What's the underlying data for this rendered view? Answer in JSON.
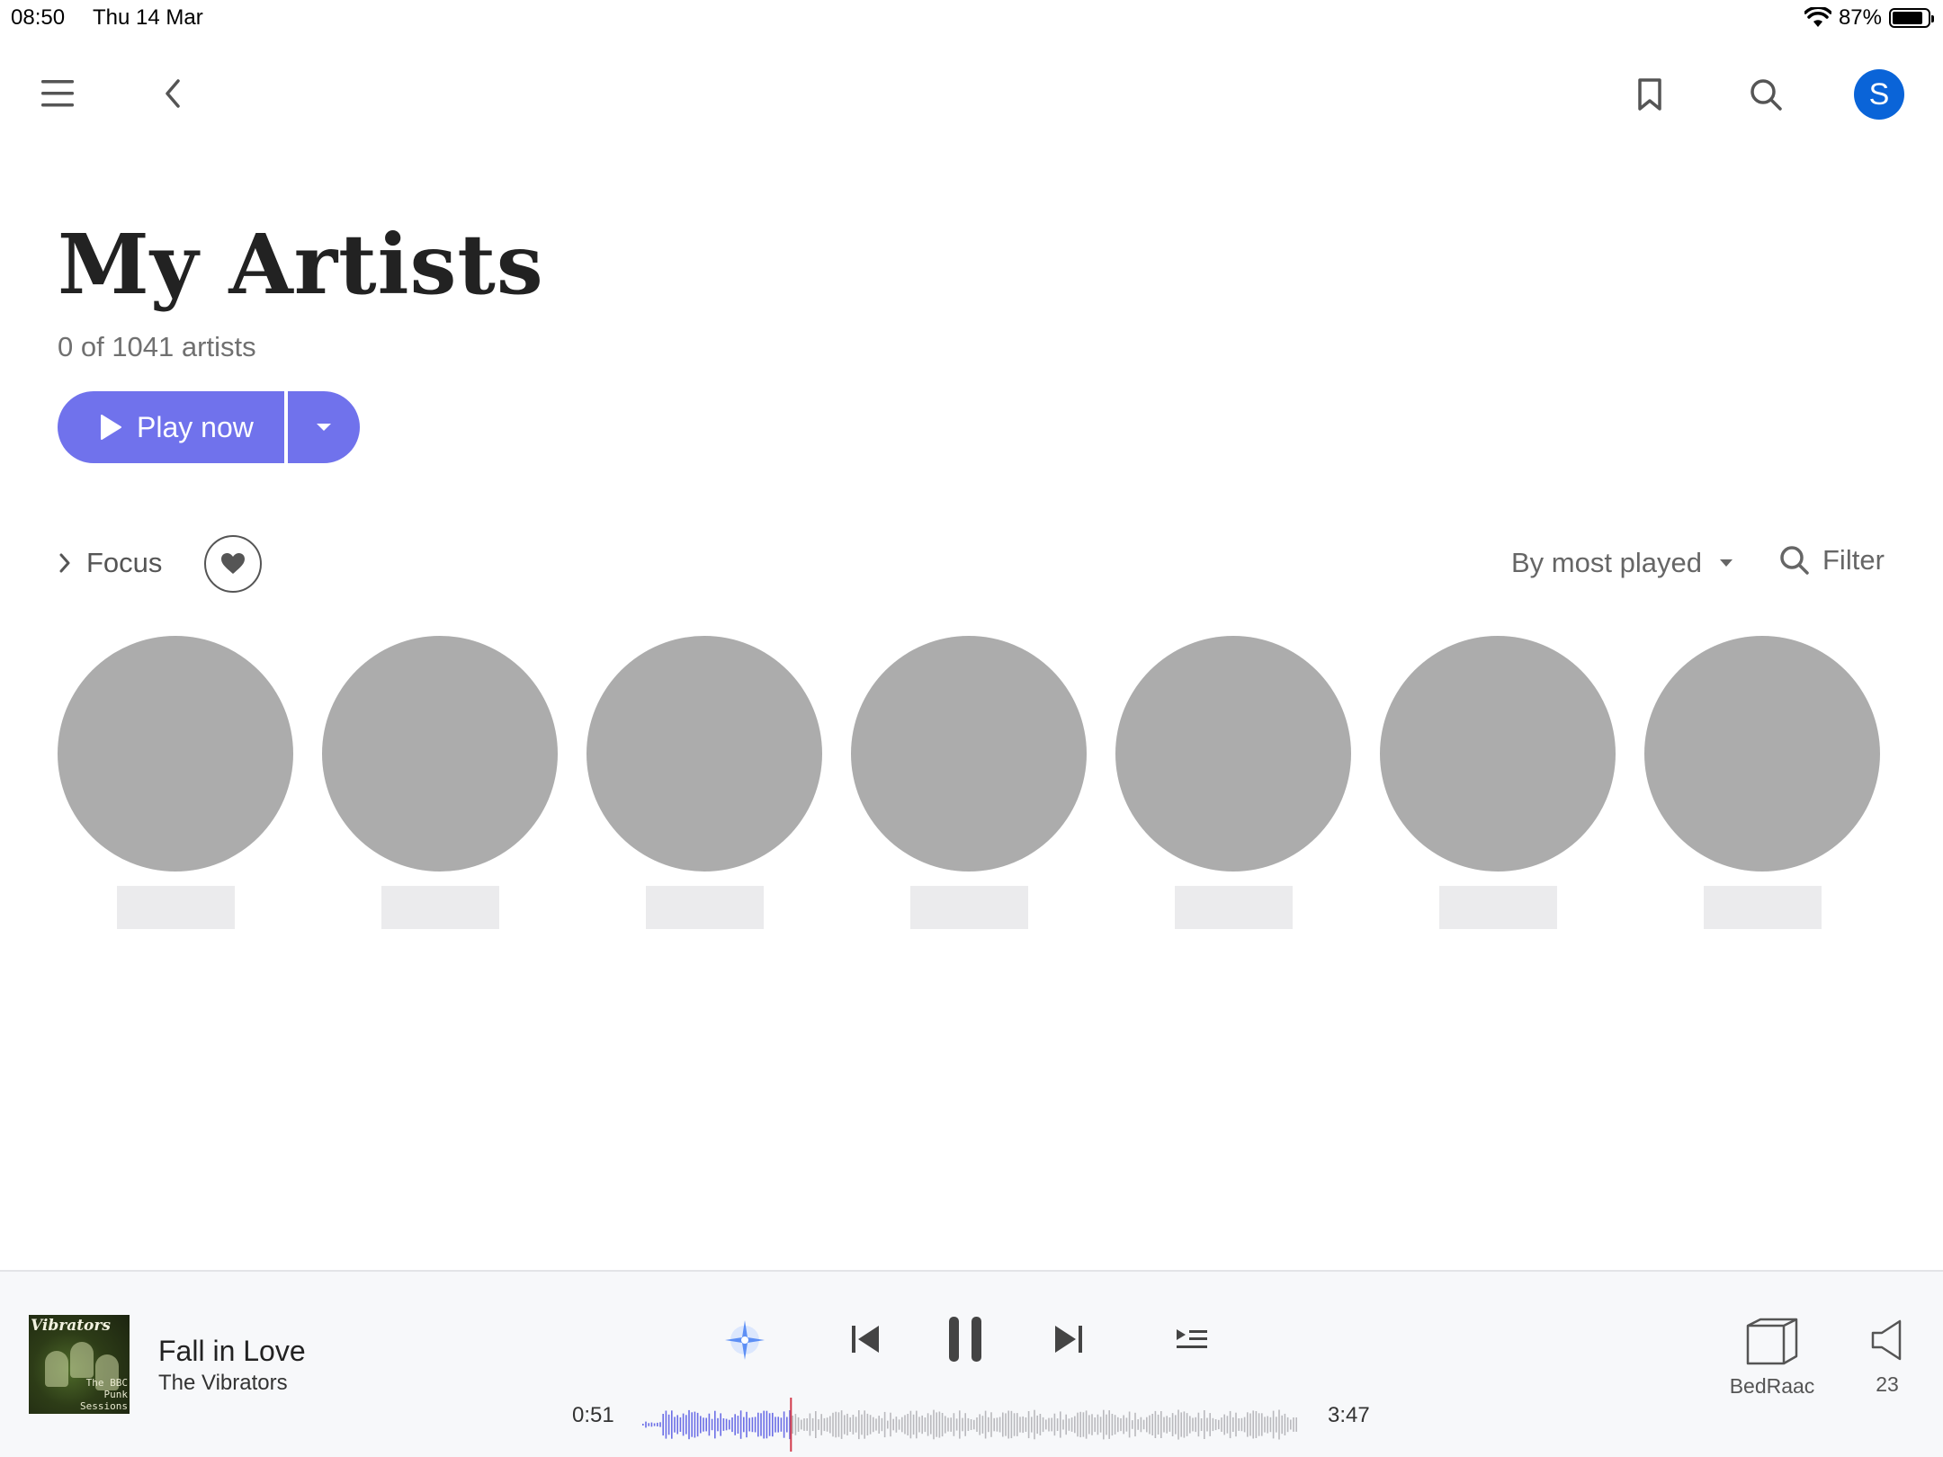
{
  "status_bar": {
    "time": "08:50",
    "date": "Thu 14 Mar",
    "battery": "87%"
  },
  "nav": {
    "avatar_initial": "S"
  },
  "header": {
    "title": "My Artists",
    "count_text": "0 of 1041 artists",
    "play_label": "Play now"
  },
  "filters": {
    "focus_label": "Focus",
    "sort_label": "By most played",
    "filter_label": "Filter"
  },
  "artists": {
    "placeholder_count": 7
  },
  "player": {
    "track_title": "Fall in Love",
    "track_artist": "The Vibrators",
    "cover_text": "Vibrators",
    "cover_subtext": "The BBC Punk Sessions",
    "elapsed": "0:51",
    "duration": "3:47",
    "progress": 0.225,
    "device_label": "BedRaac",
    "volume": "23",
    "colors": {
      "played": "#6b6ee6",
      "unplayed": "#b9b9bd",
      "playhead": "#d23b4b"
    }
  },
  "colors": {
    "accent": "#7072ec",
    "avatar": "#0a64d8",
    "placeholder": "#acacac"
  }
}
